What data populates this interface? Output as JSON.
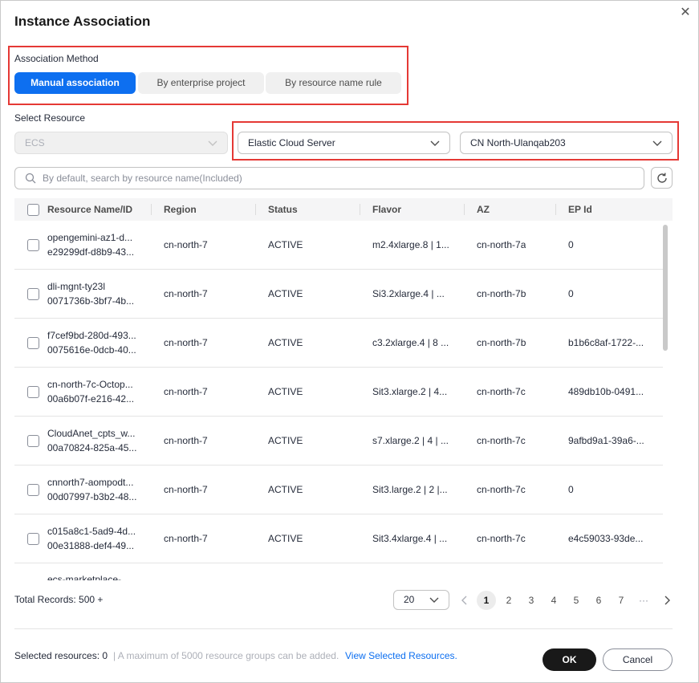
{
  "dialog": {
    "title": "Instance Association",
    "close_icon": "close-icon"
  },
  "association": {
    "label": "Association Method",
    "options": [
      "Manual association",
      "By enterprise project",
      "By resource name rule"
    ],
    "selected": "Manual association"
  },
  "resource": {
    "label": "Select Resource",
    "service": "ECS",
    "type": "Elastic Cloud Server",
    "region": "CN North-Ulanqab203"
  },
  "search": {
    "placeholder": "By default, search by resource name(Included)",
    "value": ""
  },
  "table": {
    "columns": [
      "Resource Name/ID",
      "Region",
      "Status",
      "Flavor",
      "AZ",
      "EP Id"
    ],
    "rows": [
      {
        "name": "opengemini-az1-d...",
        "id": "e29299df-d8b9-43...",
        "region": "cn-north-7",
        "status": "ACTIVE",
        "flavor": "m2.4xlarge.8 | 1...",
        "az": "cn-north-7a",
        "ep": "0"
      },
      {
        "name": "dli-mgnt-ty23l",
        "id": "0071736b-3bf7-4b...",
        "region": "cn-north-7",
        "status": "ACTIVE",
        "flavor": "Si3.2xlarge.4 | ...",
        "az": "cn-north-7b",
        "ep": "0"
      },
      {
        "name": "f7cef9bd-280d-493...",
        "id": "0075616e-0dcb-40...",
        "region": "cn-north-7",
        "status": "ACTIVE",
        "flavor": "c3.2xlarge.4 | 8 ...",
        "az": "cn-north-7b",
        "ep": "b1b6c8af-1722-..."
      },
      {
        "name": "cn-north-7c-Octop...",
        "id": "00a6b07f-e216-42...",
        "region": "cn-north-7",
        "status": "ACTIVE",
        "flavor": "Sit3.xlarge.2 | 4...",
        "az": "cn-north-7c",
        "ep": "489db10b-0491..."
      },
      {
        "name": "CloudAnet_cpts_w...",
        "id": "00a70824-825a-45...",
        "region": "cn-north-7",
        "status": "ACTIVE",
        "flavor": "s7.xlarge.2 | 4 | ...",
        "az": "cn-north-7c",
        "ep": "9afbd9a1-39a6-..."
      },
      {
        "name": "cnnorth7-aompodt...",
        "id": "00d07997-b3b2-48...",
        "region": "cn-north-7",
        "status": "ACTIVE",
        "flavor": "Sit3.large.2 | 2 |...",
        "az": "cn-north-7c",
        "ep": "0"
      },
      {
        "name": "c015a8c1-5ad9-4d...",
        "id": "00e31888-def4-49...",
        "region": "cn-north-7",
        "status": "ACTIVE",
        "flavor": "Sit3.4xlarge.4 | ...",
        "az": "cn-north-7c",
        "ep": "e4c59033-93de..."
      },
      {
        "name": "ecs-marketplace-",
        "id": "",
        "region": "",
        "status": "",
        "flavor": "",
        "az": "",
        "ep": ""
      }
    ]
  },
  "pagination": {
    "total_label": "Total Records: 500 +",
    "page_size": "20",
    "pages": [
      "1",
      "2",
      "3",
      "4",
      "5",
      "6",
      "7",
      "···"
    ],
    "current": "1"
  },
  "footer": {
    "selected_label": "Selected resources: 0",
    "max_note": "| A maximum of 5000 resource groups can be added.",
    "view_link": "View Selected Resources.",
    "ok_label": "OK",
    "cancel_label": "Cancel"
  },
  "colors": {
    "primary": "#0d6ff0",
    "highlight_box": "#e53935",
    "ok_button": "#191919",
    "link": "#0d6ff0"
  }
}
